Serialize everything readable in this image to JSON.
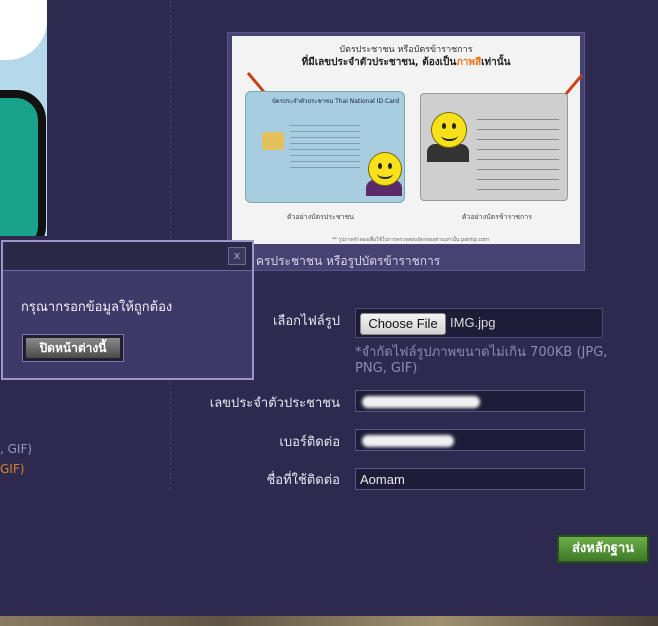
{
  "id_preview": {
    "heading_line1": "บัตรประชาชน หรือบัตรข้าราชการ",
    "heading_line2_prefix": "ที่มีเลขประจำตัวประชาชน, ต้องเป็น",
    "heading_line2_highlight": "ภาพสี",
    "heading_line2_suffix": "เท่านั้น",
    "thai_card_header": "บัตรประจำตัวประชาชน  Thai National ID Card",
    "caption_left": "ตัวอย่างบัตรประชาชน",
    "caption_right": "ตัวอย่างบัตรข้าราชการ",
    "footnote": "** รูปภาพจำลองเพื่อใช้ในการตรวจสอบบัตรของท่านเท่านั้น pantip.com",
    "upload_caption": "ครประชาชน หรือรูปบัตรข้าราชการ"
  },
  "form": {
    "file_label": "เลือกไฟล์รูป",
    "file_button": "Choose File",
    "file_name": "IMG.jpg",
    "file_hint": "*จำกัดไฟล์รูปภาพขนาดไม่เกิน 700KB (JPG, PNG, GIF)",
    "id_label": "เลขประจำตัวประชาชน",
    "phone_label": "เบอร์ติดต่อ",
    "name_label": "ชื่อที่ใช้ติดต่อ",
    "name_value": "Aomam",
    "submit_label": "ส่งหลักฐาน"
  },
  "left_panel": {
    "hint_line1": ", GIF)",
    "hint_line2": "GIF)"
  },
  "modal": {
    "close_glyph": "x",
    "message": "กรุณากรอกข้อมูลให้ถูกต้อง",
    "button_label": "ปิดหน้าต่างนี้"
  }
}
